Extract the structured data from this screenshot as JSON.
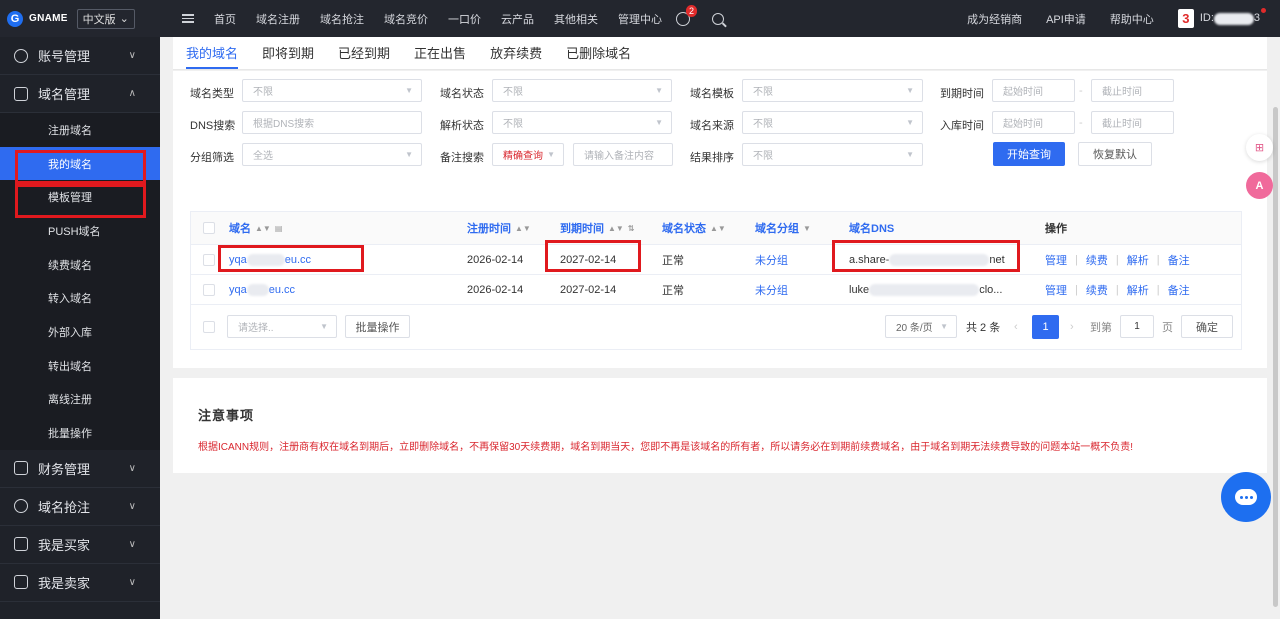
{
  "topbar": {
    "logo_letter": "G",
    "logo_text": "GNAME",
    "lang": "中文版",
    "nav": [
      "首页",
      "域名注册",
      "域名抢注",
      "域名竞价",
      "一口价",
      "云产品",
      "其他相关",
      "管理中心"
    ],
    "msg_count": "2",
    "right_links": [
      "成为经销商",
      "API申请",
      "帮助中心"
    ],
    "avatar_text": "3",
    "user_id_prefix": "ID:",
    "user_id_suffix": "3"
  },
  "sidebar": {
    "groups_top": [
      {
        "label": "账号管理",
        "icon": "user-icon"
      },
      {
        "label": "域名管理",
        "icon": "layers-icon"
      }
    ],
    "items": [
      "注册域名",
      "我的域名",
      "模板管理",
      "PUSH域名",
      "续费域名",
      "转入域名",
      "外部入库",
      "转出域名",
      "离线注册",
      "批量操作"
    ],
    "active_index": 1,
    "groups_bottom": [
      {
        "label": "财务管理",
        "icon": "finance-icon"
      },
      {
        "label": "域名抢注",
        "icon": "clock-icon"
      },
      {
        "label": "我是买家",
        "icon": "cart-icon"
      },
      {
        "label": "我是卖家",
        "icon": "shop-icon"
      }
    ]
  },
  "tabs": [
    "我的域名",
    "即将到期",
    "已经到期",
    "正在出售",
    "放弃续费",
    "已删除域名"
  ],
  "filters": {
    "labels": [
      "域名类型",
      "域名状态",
      "域名模板",
      "到期时间",
      "DNS搜索",
      "解析状态",
      "域名来源",
      "入库时间",
      "分组筛选",
      "备注搜索",
      "结果排序"
    ],
    "unlimited": "不限",
    "start_time": "起始时间",
    "end_time": "截止时间",
    "dns_placeholder": "根据DNS搜索",
    "group_all": "全选",
    "exact_query": "精确查询",
    "remark_placeholder": "请输入备注内容",
    "range_sep": "-",
    "search_button": "开始查询",
    "reset_button": "恢复默认"
  },
  "table": {
    "headers": [
      "域名",
      "注册时间",
      "到期时间",
      "域名状态",
      "域名分组",
      "域名DNS",
      "操作"
    ],
    "rows": [
      {
        "domain_prefix": "yqa",
        "domain_suffix": "eu.cc",
        "reg": "2026-02-14",
        "exp": "2027-02-14",
        "status": "正常",
        "group": "未分组",
        "dns_prefix": "a.share-",
        "dns_suffix": "net"
      },
      {
        "domain_prefix": "yqa",
        "domain_suffix": "eu.cc",
        "reg": "2026-02-14",
        "exp": "2027-02-14",
        "status": "正常",
        "group": "未分组",
        "dns_prefix": "luke",
        "dns_suffix": "clo..."
      }
    ],
    "ops": [
      "管理",
      "续费",
      "解析",
      "备注"
    ],
    "op_sep": "|",
    "bulk_select": "请选择..",
    "bulk_button": "批量操作",
    "page_size": "20 条/页",
    "total": "共 2 条",
    "current_page": "1",
    "goto_label": "到第",
    "goto_value": "1",
    "page_unit": "页",
    "confirm": "确定"
  },
  "notice": {
    "title": "注意事项",
    "text": "根据ICANN规则，注册商有权在域名到期后，立即删除域名，不再保留30天续费期，域名到期当天，您即不再是该域名的所有者，所以请务必在到期前续费域名，由于域名到期无法续费导致的问题本站一概不负责!"
  },
  "colors": {
    "accent": "#2f6bf0",
    "highlight_box": "#e0191e",
    "sidebar_bg": "#1f2229",
    "topbar_bg": "#23262e",
    "warning_text": "#d9262e"
  }
}
